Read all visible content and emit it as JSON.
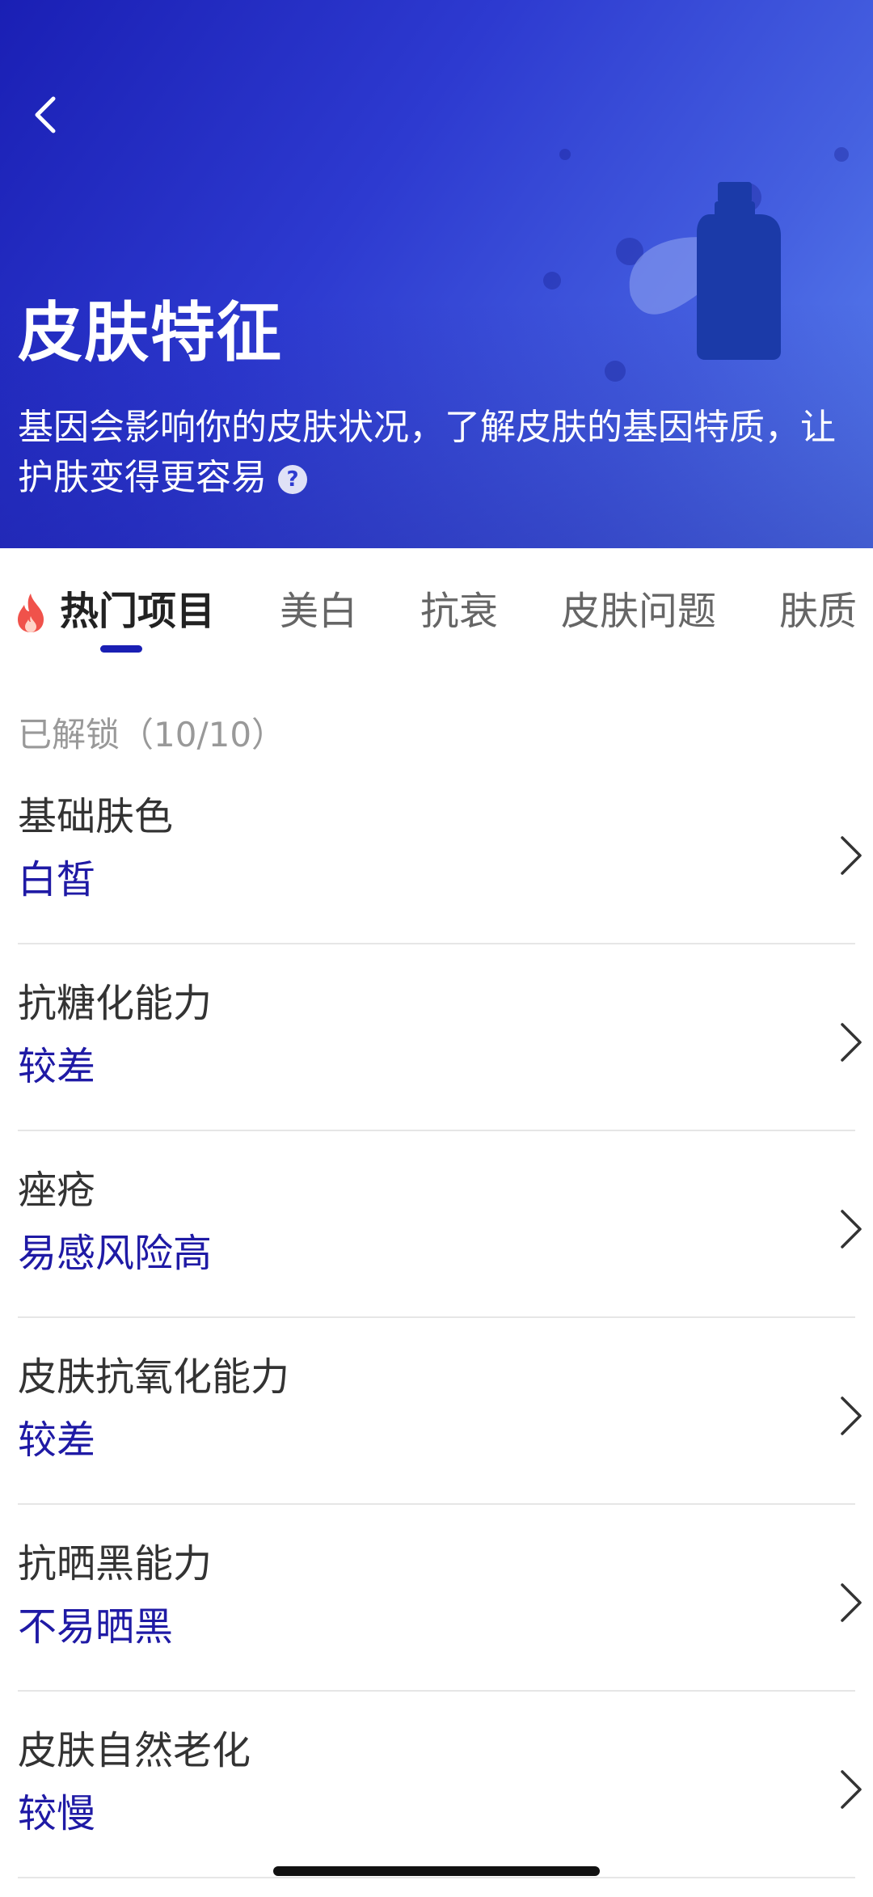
{
  "colors": {
    "hero_start": "#1a1fb4",
    "hero_end": "#5a82ee",
    "accent": "#1f1aa5",
    "tab_active_underline": "#1a1fb4",
    "fire": "#f0524b"
  },
  "header": {
    "back_icon": "chevron-left-icon",
    "title": "皮肤特征",
    "description": "基因会影响你的皮肤状况，了解皮肤的基因特质，让护肤变得更容易",
    "help_icon": "question-circle-icon",
    "help_glyph": "?"
  },
  "tabs": [
    {
      "label": "热门项目",
      "active": true,
      "icon": "fire-icon"
    },
    {
      "label": "美白",
      "active": false
    },
    {
      "label": "抗衰",
      "active": false
    },
    {
      "label": "皮肤问题",
      "active": false
    },
    {
      "label": "肤质",
      "active": false
    }
  ],
  "section": {
    "label": "已解锁（10/10）"
  },
  "items": [
    {
      "name": "基础肤色",
      "value": "白皙"
    },
    {
      "name": "抗糖化能力",
      "value": "较差"
    },
    {
      "name": "痤疮",
      "value": "易感风险高"
    },
    {
      "name": "皮肤抗氧化能力",
      "value": "较差"
    },
    {
      "name": "抗晒黑能力",
      "value": "不易晒黑"
    },
    {
      "name": "皮肤自然老化",
      "value": "较慢"
    }
  ]
}
